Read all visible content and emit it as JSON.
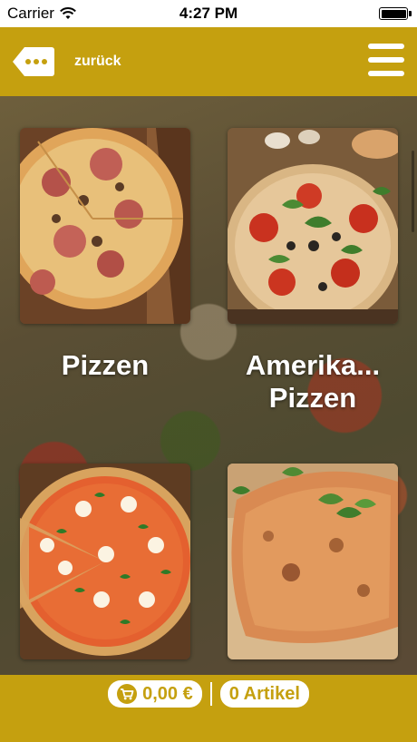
{
  "status_bar": {
    "carrier": "Carrier",
    "time": "4:27 PM"
  },
  "header": {
    "back_label": "zurück",
    "back_icon": "speech-bubble-dots-icon",
    "menu_icon": "hamburger-menu-icon"
  },
  "categories": [
    {
      "label": "Pizzen"
    },
    {
      "label": "Amerika... Pizzen"
    },
    {
      "label": ""
    },
    {
      "label": ""
    }
  ],
  "footer": {
    "cart_total": "0,00 €",
    "item_count": "0 Artikel",
    "cart_icon": "shopping-cart-icon"
  },
  "colors": {
    "accent": "#c5a00f",
    "header_text": "#ffffff"
  }
}
